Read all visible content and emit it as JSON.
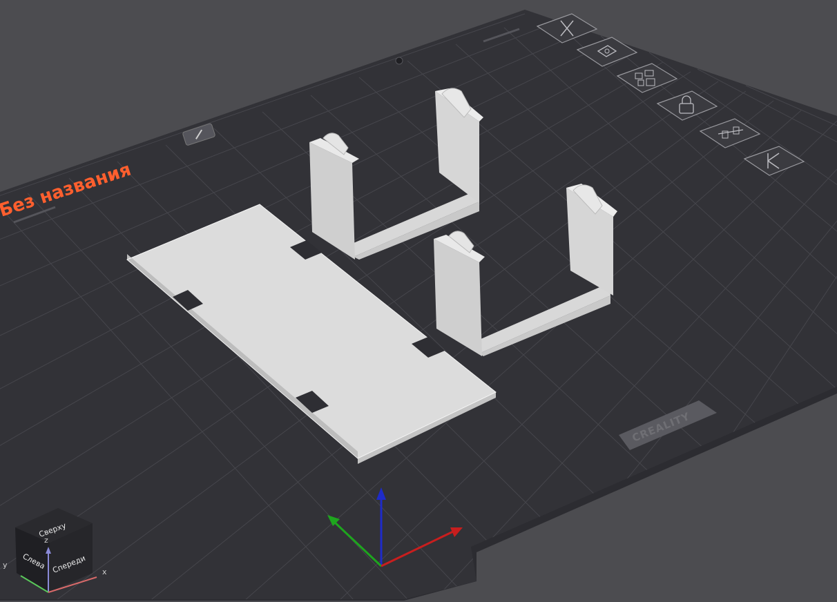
{
  "plate": {
    "name": "Без названия",
    "brand": "CREALITY"
  },
  "toolbar": {
    "buttons": [
      {
        "name": "close-plate-button",
        "icon": "close-icon"
      },
      {
        "name": "auto-orient-button",
        "icon": "orient-icon"
      },
      {
        "name": "arrange-button",
        "icon": "arrange-icon"
      },
      {
        "name": "lock-button",
        "icon": "lock-icon"
      },
      {
        "name": "settings-button",
        "icon": "sliders-icon"
      },
      {
        "name": "move-button",
        "icon": "arrow-icon"
      }
    ]
  },
  "view_cube": {
    "top": "Сверху",
    "left": "Слева",
    "front": "Спереди",
    "axis_x": "x",
    "axis_y": "y",
    "axis_z": "z"
  },
  "colors": {
    "plate_name": "#ff5f2e",
    "axis_x": "#c81e1e",
    "axis_y": "#1ea51e",
    "axis_z": "#1e2bc8",
    "model": "#e3e3e3"
  }
}
